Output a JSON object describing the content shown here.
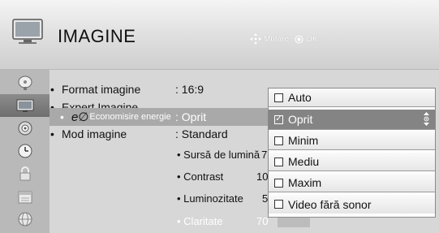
{
  "header": {
    "title": "IMAGINE",
    "hint_move": "Mutare",
    "hint_ok": "OK",
    "icon": "tv-screen-icon"
  },
  "sidebar": {
    "items": [
      {
        "name": "satellite-dish-icon",
        "active": false
      },
      {
        "name": "tv-screen-icon",
        "active": true
      },
      {
        "name": "speaker-icon",
        "active": false
      },
      {
        "name": "clock-icon",
        "active": false
      },
      {
        "name": "lock-icon",
        "active": false
      },
      {
        "name": "calendar-icon",
        "active": false
      },
      {
        "name": "globe-icon",
        "active": false
      }
    ]
  },
  "settings": {
    "format": {
      "label": "Format imagine",
      "value": ": 16:9"
    },
    "expert": {
      "label": "Expert Imagine"
    },
    "energy": {
      "logo": "e∅",
      "label": "Economisire energie",
      "value": ": Oprit"
    },
    "mode": {
      "label": "Mod imagine",
      "value": ": Standard"
    },
    "backlight": {
      "label": "• Sursă de lumină",
      "value": "7"
    },
    "contrast": {
      "label": "• Contrast",
      "value": "10"
    },
    "brightness": {
      "label": "• Luminozitate",
      "value": "5"
    },
    "sharpness": {
      "label": "• Claritate",
      "value": "70"
    }
  },
  "dropdown": {
    "options": [
      {
        "label": "Auto",
        "checked": false
      },
      {
        "label": "Oprit",
        "checked": true
      },
      {
        "label": "Minim",
        "checked": false
      },
      {
        "label": "Mediu",
        "checked": false
      },
      {
        "label": "Maxim",
        "checked": false
      },
      {
        "label": "Video fără sonor",
        "checked": false
      }
    ],
    "check_glyph": "✓"
  }
}
